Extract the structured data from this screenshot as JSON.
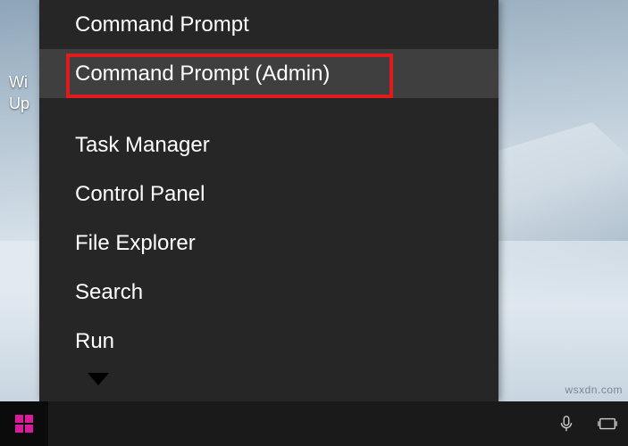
{
  "desktop": {
    "cutoff_text_line1": "Wi",
    "cutoff_text_line2": "Up"
  },
  "menu": {
    "items": [
      {
        "label": "Command Prompt",
        "hovered": false
      },
      {
        "label": "Command Prompt (Admin)",
        "hovered": true,
        "highlighted": true
      },
      {
        "label": "Task Manager",
        "hovered": false
      },
      {
        "label": "Control Panel",
        "hovered": false
      },
      {
        "label": "File Explorer",
        "hovered": false
      },
      {
        "label": "Search",
        "hovered": false
      },
      {
        "label": "Run",
        "hovered": false
      }
    ]
  },
  "watermark": "wsxdn.com"
}
